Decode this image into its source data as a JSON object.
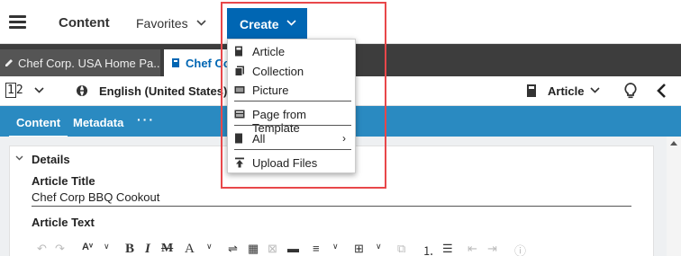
{
  "header": {
    "app_title": "Content",
    "favorites_label": "Favorites",
    "create_label": "Create"
  },
  "tabs": [
    {
      "label": "Chef Corp. USA Home Pa...",
      "active": false
    },
    {
      "label": "Chef Cor",
      "active": true
    }
  ],
  "toolbar": {
    "page_indicator_1": "1",
    "page_indicator_2": "2",
    "locale": "English (United States)",
    "doc_type": "Article"
  },
  "content_tabs": {
    "content": "Content",
    "metadata": "Metadata",
    "more": "···"
  },
  "form": {
    "section_label": "Details",
    "article_title_label": "Article Title",
    "article_title_value": "Chef Corp BBQ Cookout",
    "article_text_label": "Article Text"
  },
  "create_menu": {
    "items": [
      {
        "label": "Article",
        "icon": "article-icon"
      },
      {
        "label": "Collection",
        "icon": "collection-icon"
      },
      {
        "label": "Picture",
        "icon": "picture-icon"
      },
      {
        "label": "Page from Template",
        "icon": "template-icon"
      },
      {
        "label": "All",
        "icon": "all-icon",
        "submenu_arrow": "›"
      },
      {
        "label": "Upload Files",
        "icon": "upload-icon"
      }
    ]
  },
  "colors": {
    "accent": "#0066b3",
    "content_tabs_bg": "#2a8ac1",
    "tabbar_bg": "#3d3d3d",
    "highlight": "#e8474a"
  }
}
